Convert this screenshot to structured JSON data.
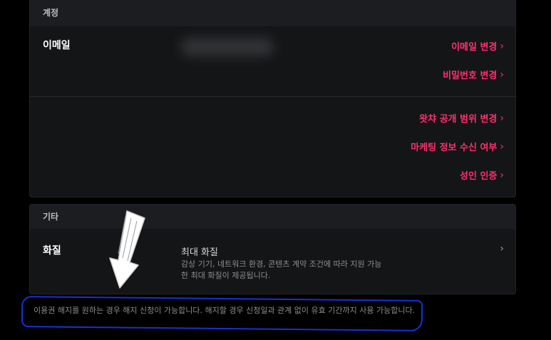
{
  "account": {
    "header": "계정",
    "email_label": "이메일",
    "links": {
      "change_email": "이메일 변경",
      "change_password": "비밀번호 변경",
      "watch_scope": "왓챠 공개 범위 변경",
      "marketing": "마케팅 정보 수신 여부",
      "adult_verify": "성인 인증"
    }
  },
  "other": {
    "header": "기타",
    "quality_label": "화질",
    "quality_value": "최대 화질",
    "quality_desc": "감상 기기, 네트워크 환경, 콘텐츠 계약 조건에 따라 지원 가능한 최대 화질이 제공됩니다."
  },
  "notice": "이용권 해지를 원하는 경우 해지 신청이 가능합니다. 해지할 경우 신청일과 관계 없이 유효 기간까지 사용 가능합니다.",
  "colors": {
    "accent": "#ff2f6e",
    "annotation_circle": "#1a2fd6",
    "card_bg": "#141517",
    "header_bg": "#1c1d20"
  },
  "icons": {
    "chevron": "chevron-right-icon",
    "annotation_arrow": "hand-drawn-arrow-down-icon"
  }
}
